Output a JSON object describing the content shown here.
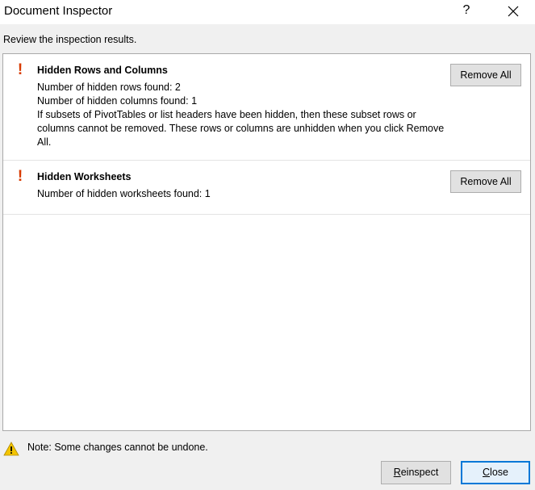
{
  "window": {
    "title": "Document Inspector",
    "help_label": "?"
  },
  "subtitle": "Review the inspection results.",
  "results": [
    {
      "title": "Hidden Rows and Columns",
      "lines": [
        "Number of hidden rows found: 2",
        "Number of hidden columns found: 1",
        "If subsets of PivotTables or list headers have been hidden, then these subset rows or columns cannot be removed. These rows or columns are unhidden when you click Remove All."
      ],
      "button_label": "Remove All"
    },
    {
      "title": "Hidden Worksheets",
      "lines": [
        "Number of hidden worksheets found: 1"
      ],
      "button_label": "Remove All"
    }
  ],
  "note": "Note: Some changes cannot be undone.",
  "footer": {
    "reinspect_first": "R",
    "reinspect_rest": "einspect",
    "close_first": "C",
    "close_rest": "lose"
  },
  "colors": {
    "alert": "#d83b01",
    "warning": "#f3c400",
    "focus": "#0078d7"
  },
  "icons": {
    "alert": "exclamation-icon",
    "warning": "warning-triangle-icon",
    "close": "close-icon"
  }
}
